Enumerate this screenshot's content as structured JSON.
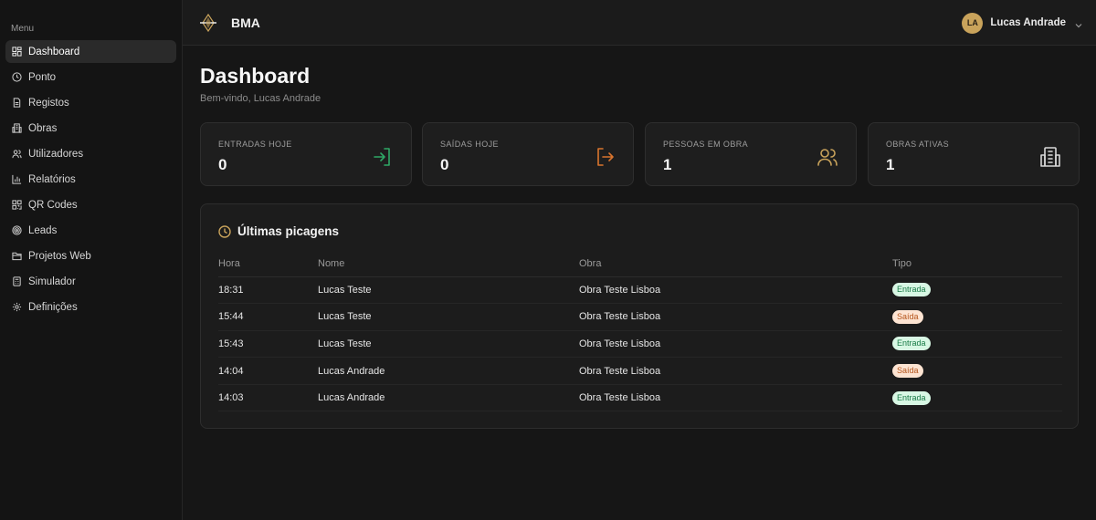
{
  "sidebar": {
    "menu_label": "Menu",
    "items": [
      {
        "label": "Dashboard",
        "icon": "dashboard-icon"
      },
      {
        "label": "Ponto",
        "icon": "clock-icon"
      },
      {
        "label": "Registos",
        "icon": "file-icon"
      },
      {
        "label": "Obras",
        "icon": "building-icon"
      },
      {
        "label": "Utilizadores",
        "icon": "users-icon"
      },
      {
        "label": "Relatórios",
        "icon": "bar-chart-icon"
      },
      {
        "label": "QR Codes",
        "icon": "qr-code-icon"
      },
      {
        "label": "Leads",
        "icon": "target-icon"
      },
      {
        "label": "Projetos Web",
        "icon": "folder-icon"
      },
      {
        "label": "Simulador",
        "icon": "calculator-icon"
      },
      {
        "label": "Definições",
        "icon": "gear-icon"
      }
    ],
    "active_item": "Dashboard"
  },
  "header": {
    "brand": "BMA",
    "user_initials": "LA",
    "user_name": "Lucas Andrade"
  },
  "main": {
    "title": "Dashboard",
    "subtitle": "Bem-vindo, Lucas Andrade",
    "stats": [
      {
        "label": "ENTRADAS HOJE",
        "value": "0",
        "icon": "enter-icon",
        "color": "#2fa866"
      },
      {
        "label": "SAÍDAS HOJE",
        "value": "0",
        "icon": "exit-icon",
        "color": "#d9752e"
      },
      {
        "label": "PESSOAS EM OBRA",
        "value": "1",
        "icon": "users-icon",
        "color": "#c9a35b"
      },
      {
        "label": "OBRAS ATIVAS",
        "value": "1",
        "icon": "building-icon",
        "color": "#d8d8d8"
      }
    ],
    "panel": {
      "title": "Últimas picagens",
      "columns": [
        "Hora",
        "Nome",
        "Obra",
        "Tipo"
      ],
      "rows": [
        {
          "hora": "18:31",
          "nome": "Lucas Teste",
          "obra": "Obra Teste Lisboa",
          "tipo": "Entrada"
        },
        {
          "hora": "15:44",
          "nome": "Lucas Teste",
          "obra": "Obra Teste Lisboa",
          "tipo": "Saída"
        },
        {
          "hora": "15:43",
          "nome": "Lucas Teste",
          "obra": "Obra Teste Lisboa",
          "tipo": "Entrada"
        },
        {
          "hora": "14:04",
          "nome": "Lucas Andrade",
          "obra": "Obra Teste Lisboa",
          "tipo": "Saída"
        },
        {
          "hora": "14:03",
          "nome": "Lucas Andrade",
          "obra": "Obra Teste Lisboa",
          "tipo": "Entrada"
        }
      ]
    }
  },
  "colors": {
    "accent": "#c9a35b",
    "entrada_badge": "#d8f7e4",
    "saida_badge": "#fde4d2"
  }
}
